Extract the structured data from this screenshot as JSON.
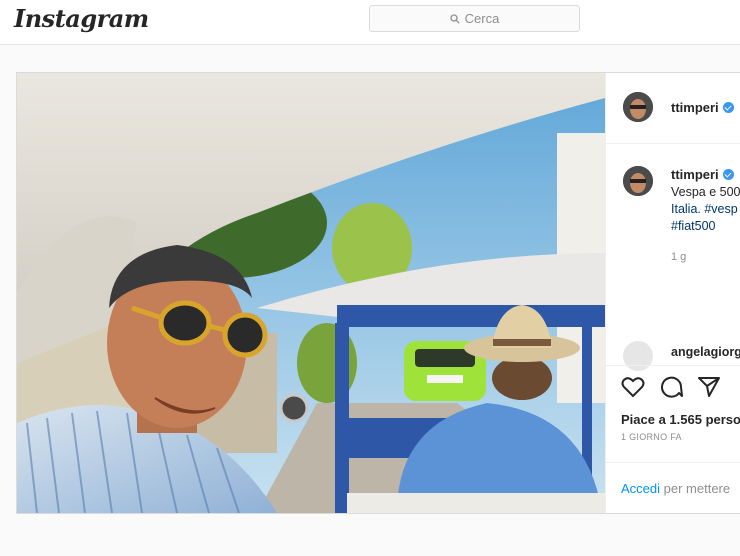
{
  "brand": {
    "logo": "Instagram"
  },
  "search": {
    "placeholder": "Cerca"
  },
  "post": {
    "username": "ttimperi",
    "caption_user": "ttimperi",
    "caption_lines": [
      "Vespa e 500",
      "Italia. #vesp",
      "#fiat500"
    ],
    "caption_time": "1 g",
    "commenter": "angelagiorg",
    "likes": "Piace a 1.565 perso",
    "date": "1 GIORNO FA",
    "login_link": "Accedi",
    "login_rest": " per mettere"
  },
  "icons": [
    "search-icon",
    "verified-badge-icon",
    "heart-icon",
    "comment-icon",
    "share-icon"
  ],
  "colors": {
    "accent": "#0095f6",
    "verified": "#3897f0",
    "hashtag": "#00376b"
  }
}
